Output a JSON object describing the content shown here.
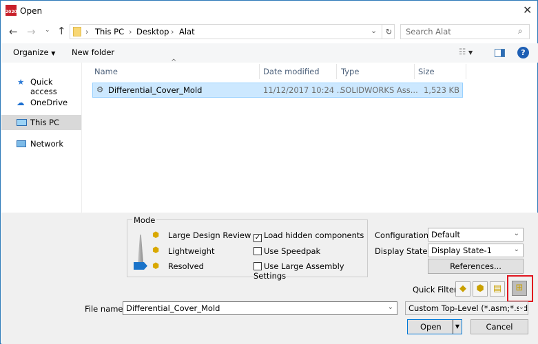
{
  "window": {
    "title": "Open",
    "app_badge": "2020"
  },
  "nav": {
    "breadcrumb": [
      "This PC",
      "Desktop",
      "Alat"
    ],
    "search_placeholder": "Search Alat"
  },
  "toolbar": {
    "organize": "Organize",
    "new_folder": "New folder"
  },
  "sidebar": {
    "items": [
      {
        "label": "Quick access",
        "icon": "star-icon"
      },
      {
        "label": "OneDrive",
        "icon": "cloud-icon"
      },
      {
        "label": "This PC",
        "icon": "computer-icon",
        "selected": true
      },
      {
        "label": "Network",
        "icon": "network-icon"
      }
    ]
  },
  "columns": [
    "Name",
    "Date modified",
    "Type",
    "Size"
  ],
  "files": [
    {
      "name": "Differential_Cover_Mold",
      "date": "11/12/2017 10:24 ...",
      "type": "SOLIDWORKS Ass...",
      "size": "1,523 KB",
      "selected": true
    }
  ],
  "mode": {
    "title": "Mode",
    "options": [
      "Large Design Review",
      "Lightweight",
      "Resolved"
    ],
    "selected": "Resolved",
    "checkboxes": [
      {
        "label": "Load hidden components",
        "checked": true
      },
      {
        "label": "Use Speedpak",
        "checked": false
      },
      {
        "label": "Use Large Assembly Settings",
        "checked": false
      }
    ]
  },
  "configuration": {
    "label": "Configuration:",
    "value": "Default"
  },
  "display_state": {
    "label": "Display State:",
    "value": "Display State-1"
  },
  "references_label": "References...",
  "quick_filter": {
    "label": "Quick Filter:",
    "buttons": [
      "filter-parts-icon",
      "filter-assemblies-icon",
      "filter-drawings-icon",
      "filter-top-level-assemblies-icon"
    ],
    "active": "filter-top-level-assemblies-icon",
    "highlight_color": "#e0141e"
  },
  "file_name": {
    "label": "File name:",
    "value": "Differential_Cover_Mold"
  },
  "file_type": {
    "value": "Custom Top-Level (*.asm;*.sldasm)"
  },
  "actions": {
    "open": "Open",
    "cancel": "Cancel"
  },
  "colors": {
    "selection": "#cce8ff",
    "accent": "#0078d7"
  }
}
